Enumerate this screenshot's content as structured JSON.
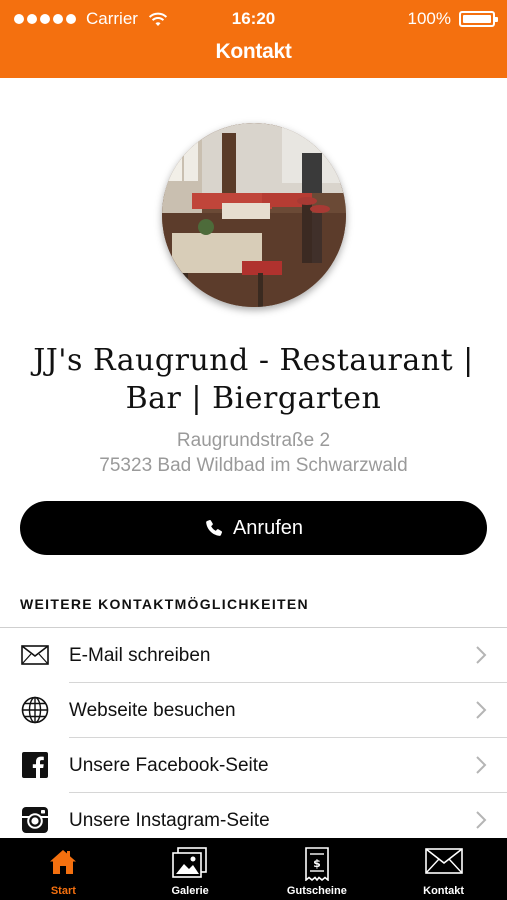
{
  "status_bar": {
    "carrier": "Carrier",
    "time": "16:20",
    "battery": "100%"
  },
  "header": {
    "title": "Kontakt",
    "color": "#f4700f"
  },
  "business": {
    "name": "JJ's Raugrund - Restaurant | Bar | Biergarten",
    "address_line1": "Raugrundstraße 2",
    "address_line2": "75323 Bad Wildbad im Schwarzwald"
  },
  "call_button": {
    "label": "Anrufen",
    "icon": "phone-icon"
  },
  "section": {
    "title": "WEITERE KONTAKTMÖGLICHKEITEN"
  },
  "contact_items": [
    {
      "label": "E-Mail schreiben",
      "icon": "mail-icon"
    },
    {
      "label": "Webseite besuchen",
      "icon": "globe-icon"
    },
    {
      "label": "Unsere Facebook-Seite",
      "icon": "facebook-icon"
    },
    {
      "label": "Unsere Instagram-Seite",
      "icon": "instagram-icon"
    }
  ],
  "tabs": [
    {
      "label": "Start",
      "icon": "home-icon",
      "active": true
    },
    {
      "label": "Galerie",
      "icon": "gallery-icon",
      "active": false
    },
    {
      "label": "Gutscheine",
      "icon": "voucher-icon",
      "active": false
    },
    {
      "label": "Kontakt",
      "icon": "envelope-icon",
      "active": false
    }
  ]
}
